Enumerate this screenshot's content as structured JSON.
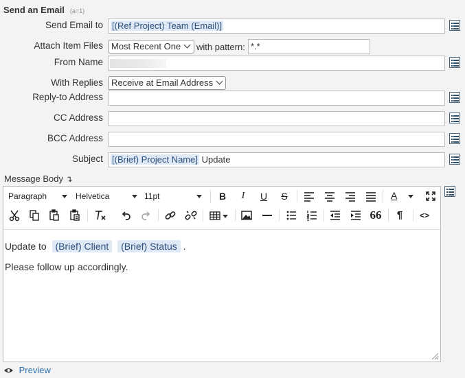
{
  "header": {
    "title": "Send an Email",
    "count": "(a=1)"
  },
  "form": {
    "send_to": {
      "label": "Send Email to",
      "token": "[(Ref Project) Team (Email)]"
    },
    "attach": {
      "label": "Attach Item Files",
      "option": "Most Recent One",
      "pattern_label": "with pattern:",
      "pattern_value": "*.*"
    },
    "from_name": {
      "label": "From Name",
      "value": ""
    },
    "replies": {
      "label": "With Replies",
      "option": "Receive at Email Address"
    },
    "reply_to": {
      "label": "Reply-to Address",
      "value": ""
    },
    "cc": {
      "label": "CC Address",
      "value": ""
    },
    "bcc": {
      "label": "BCC Address",
      "value": ""
    },
    "subject": {
      "label": "Subject",
      "token": "[(Brief) Project Name]",
      "rest": " Update"
    },
    "message": {
      "label": "Message Body",
      "arrow": "↴"
    }
  },
  "toolbar": {
    "block_format": "Paragraph",
    "font_family": "Helvetica",
    "font_size": "11pt",
    "bold": "B",
    "italic": "I",
    "underline": "U",
    "strike": "S",
    "text_color": "A",
    "blockquote": "66",
    "pilcrow": "¶",
    "code": "<>"
  },
  "body": {
    "line1_prefix": "Update to",
    "chip1": "(Brief) Client",
    "chip2": "(Brief) Status",
    "line1_suffix": ".",
    "line2": "Please follow up accordingly."
  },
  "footer": {
    "preview": "Preview"
  },
  "colors": {
    "token_bg": "#dfe9f6",
    "link": "#2f6fad",
    "background": "#f3f3f3"
  }
}
